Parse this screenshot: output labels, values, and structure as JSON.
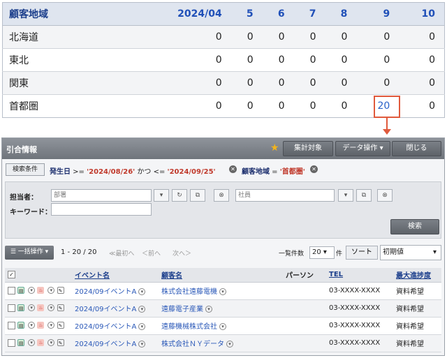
{
  "pivot": {
    "header_label": "顧客地域",
    "columns": [
      "2024/04",
      "5",
      "6",
      "7",
      "8",
      "9",
      "10"
    ],
    "rows": [
      {
        "label": "北海道",
        "values": [
          "0",
          "0",
          "0",
          "0",
          "0",
          "0",
          "0"
        ]
      },
      {
        "label": "東北",
        "values": [
          "0",
          "0",
          "0",
          "0",
          "0",
          "0",
          "0"
        ]
      },
      {
        "label": "関東",
        "values": [
          "0",
          "0",
          "0",
          "0",
          "0",
          "0",
          "0"
        ]
      },
      {
        "label": "首都圏",
        "values": [
          "0",
          "0",
          "0",
          "0",
          "0",
          "20",
          "0"
        ]
      }
    ]
  },
  "window": {
    "title": "引合情報",
    "buttons": {
      "aggregate": "集計対象",
      "data_ops": "データ操作 ▾",
      "close": "閉じる"
    },
    "conditions": {
      "button": "検索条件",
      "c1_key": "発生日",
      "c1_op1": " >= ",
      "c1_val1": "'2024/08/26'",
      "c1_mid": " かつ <= ",
      "c1_val2": "'2024/09/25'",
      "c2_key": "顧客地域",
      "c2_op": " = ",
      "c2_val": "'首都圏'"
    },
    "search": {
      "owner_label": "担当者：",
      "dept_placeholder": "部署",
      "staff_placeholder": "社員",
      "keyword_label": "キーワード：",
      "search_button": "検索"
    },
    "list": {
      "bulk_label": "☰ 一括操作 ▾",
      "range": "1 - 20 / 20",
      "first": "≪最初へ",
      "prev": "＜前へ",
      "next": "次へ＞",
      "per_page_label": "一覧件数",
      "per_page_value": "20",
      "per_page_unit": "件",
      "sort_label": "ソート",
      "sort_value": "初期値"
    },
    "grid": {
      "headers": {
        "check": "✓",
        "event": "イベント名",
        "customer": "顧客名",
        "person": "パーソン",
        "tel": "TEL",
        "progress": "最大進捗度"
      },
      "rows": [
        {
          "event": "2024/09イベントA",
          "customer": "株式会社遠藤電機",
          "person": "",
          "tel": "03-XXXX-XXXX",
          "progress": "資料希望"
        },
        {
          "event": "2024/09イベントA",
          "customer": "遠藤電子産業",
          "person": "",
          "tel": "03-XXXX-XXXX",
          "progress": "資料希望"
        },
        {
          "event": "2024/09イベントA",
          "customer": "遠藤機械株式会社",
          "person": "",
          "tel": "03-XXXX-XXXX",
          "progress": "資料希望"
        },
        {
          "event": "2024/09イベントA",
          "customer": "株式会社ＮＹデータ",
          "person": "",
          "tel": "03-XXXX-XXXX",
          "progress": "資料希望"
        }
      ]
    }
  },
  "colors": {
    "highlight": "#e05a3c",
    "link": "#2a58b8",
    "header_blue": "#1c3f8c"
  }
}
